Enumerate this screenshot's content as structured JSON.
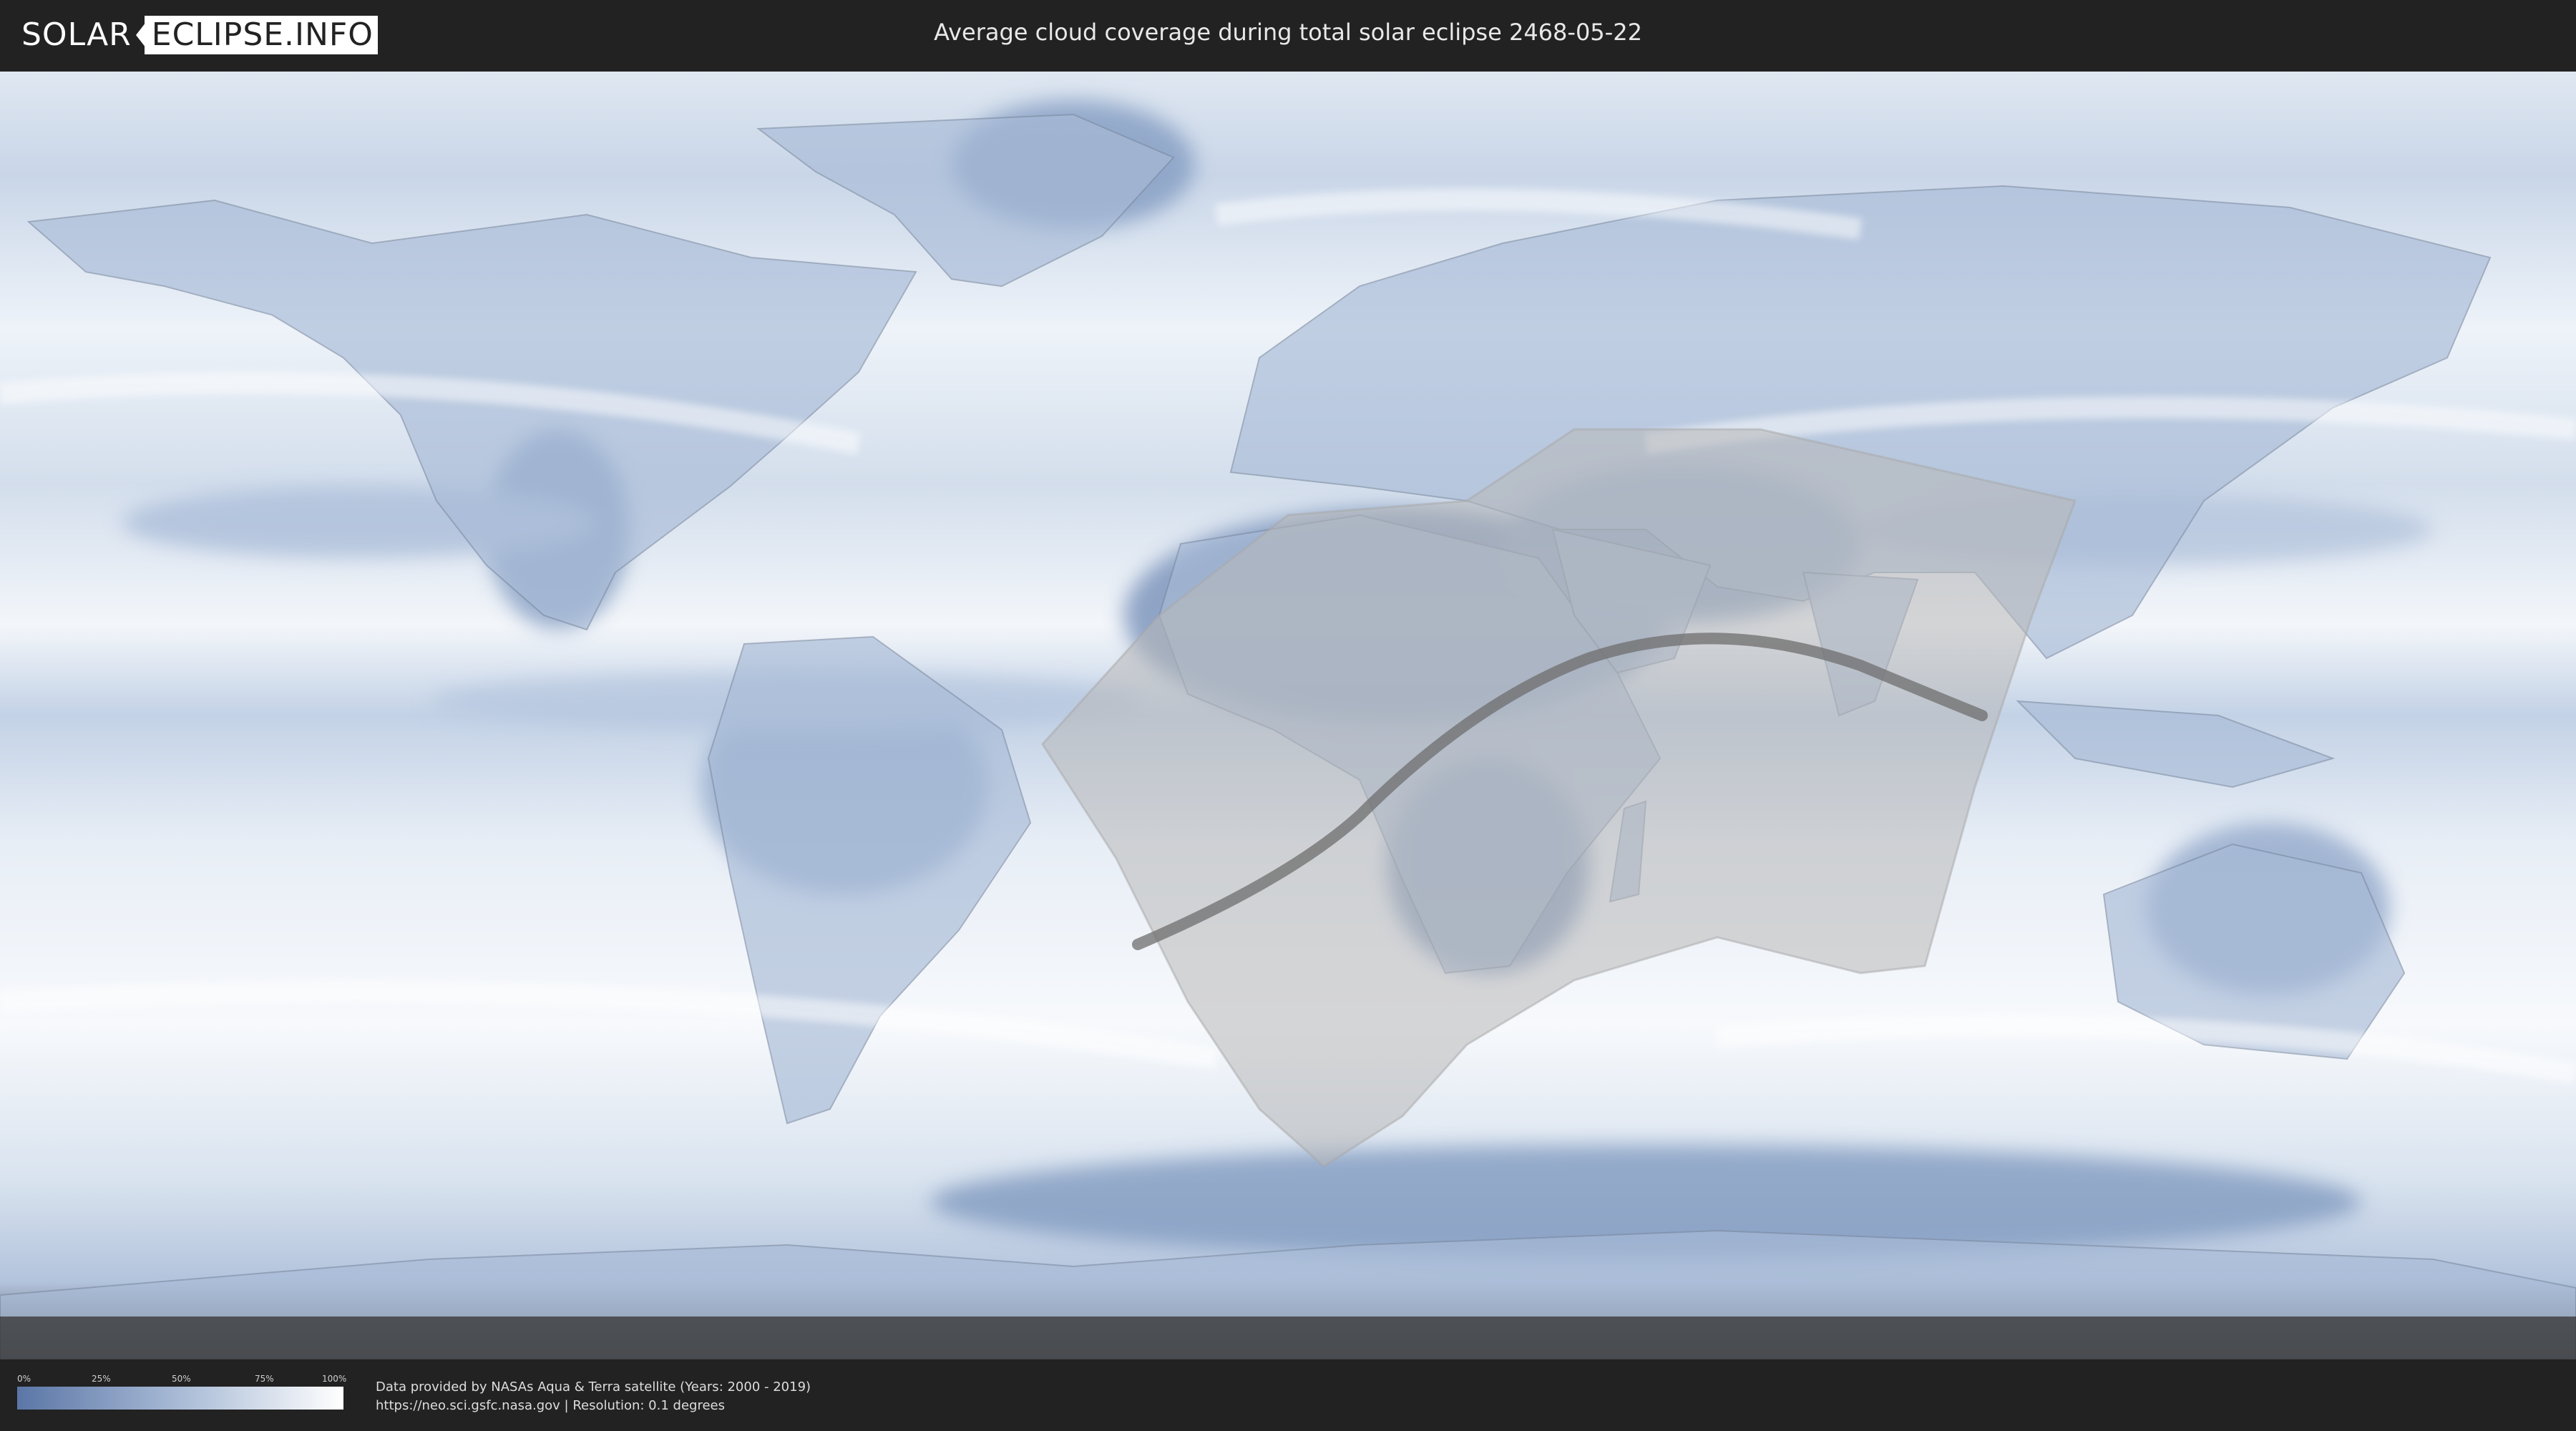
{
  "header": {
    "logo_left": "SOLAR",
    "logo_right": "ECLIPSE.INFO",
    "title": "Average cloud coverage during total solar eclipse 2468-05-22"
  },
  "legend": {
    "ticks": [
      "0%",
      "25%",
      "50%",
      "75%",
      "100%"
    ],
    "color_low": "#5b76a6",
    "color_high": "#ffffff"
  },
  "credits": {
    "line1": "Data provided by NASAs Aqua & Terra satellite (Years: 2000 - 2019)",
    "line2": "https://neo.sci.gsfc.nasa.gov | Resolution: 0.1 degrees"
  },
  "map": {
    "projection": "equirectangular",
    "ocean_color": "#e3ebf5",
    "land_color": "#9fb4d2",
    "cloud_dark": "#6f8ab5",
    "penumbra_color": "#bdbdbd",
    "central_line_color": "#6e6e6e"
  }
}
